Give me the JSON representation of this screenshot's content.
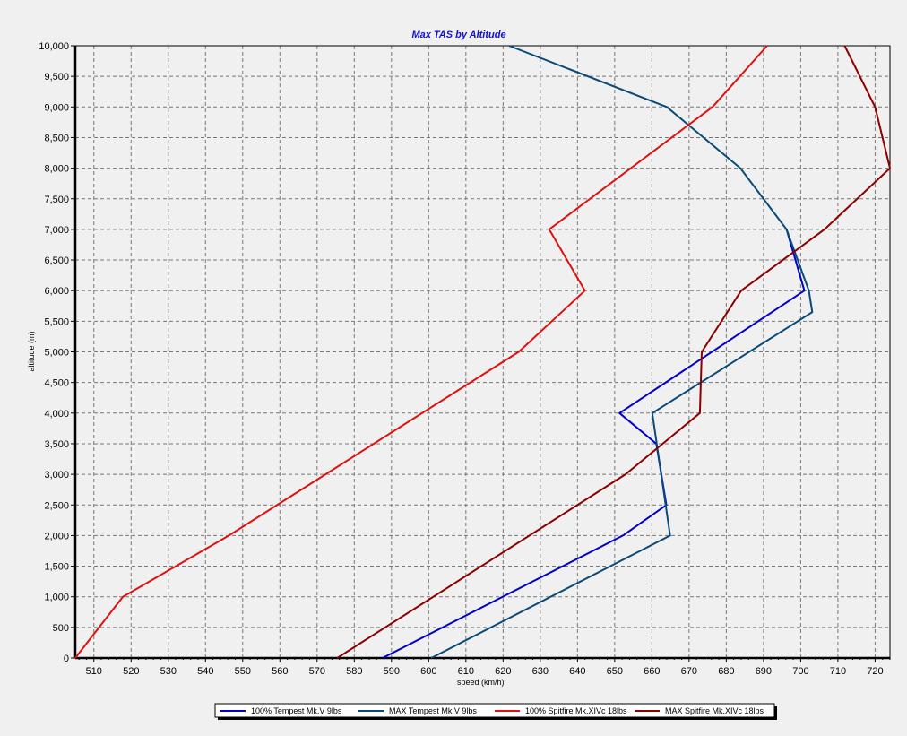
{
  "chart_data": {
    "type": "line",
    "title": "Max TAS by Altitude",
    "xlabel": "speed (km/h)",
    "ylabel": "altitude (m)",
    "xlim": [
      505,
      724
    ],
    "ylim": [
      0,
      10000
    ],
    "xticks": [
      510,
      520,
      530,
      540,
      550,
      560,
      570,
      580,
      590,
      600,
      610,
      620,
      630,
      640,
      650,
      660,
      670,
      680,
      690,
      700,
      710,
      720
    ],
    "yticks": [
      0,
      500,
      1000,
      1500,
      2000,
      2500,
      3000,
      3500,
      4000,
      4500,
      5000,
      5500,
      6000,
      6500,
      7000,
      7500,
      8000,
      8500,
      9000,
      9500,
      10000
    ],
    "ytick_labels": [
      "0",
      "500",
      "1,000",
      "1,500",
      "2,000",
      "2,500",
      "3,000",
      "3,500",
      "4,000",
      "4,500",
      "5,000",
      "5,500",
      "6,000",
      "6,500",
      "7,000",
      "7,500",
      "8,000",
      "8,500",
      "9,000",
      "9,500",
      "10,000"
    ],
    "grid": true,
    "legend_position": "bottom",
    "series": [
      {
        "name": "100% Tempest Mk.V  9lbs",
        "color": "#0000cc",
        "points": [
          [
            587.6,
            0
          ],
          [
            652.2,
            2000
          ],
          [
            663.9,
            2500
          ],
          [
            661.2,
            3500
          ],
          [
            651.3,
            4000
          ],
          [
            701.0,
            6000
          ],
          [
            696.2,
            7000
          ]
        ]
      },
      {
        "name": "MAX Tempest Mk.V  9lbs",
        "color": "#0b4a78",
        "points": [
          [
            600.7,
            0
          ],
          [
            664.9,
            2000
          ],
          [
            660.1,
            4000
          ],
          [
            703.1,
            5650
          ],
          [
            702.2,
            6000
          ],
          [
            696.2,
            7000
          ],
          [
            683.8,
            8000
          ],
          [
            664.0,
            9000
          ],
          [
            621.6,
            10000
          ]
        ]
      },
      {
        "name": "100% Spitfire Mk.XIVc 18lbs",
        "color": "#e01010",
        "points": [
          [
            505.0,
            0
          ],
          [
            517.8,
            1000
          ],
          [
            546.3,
            2000
          ],
          [
            624.2,
            5000
          ],
          [
            642.0,
            6000
          ],
          [
            632.4,
            7000
          ],
          [
            676.3,
            9000
          ],
          [
            691.0,
            10000
          ]
        ]
      },
      {
        "name": "MAX Spitfire Mk.XIVc 18lbs",
        "color": "#8b0000",
        "points": [
          [
            575.4,
            0
          ],
          [
            652.9,
            3000
          ],
          [
            672.9,
            4000
          ],
          [
            673.4,
            5000
          ],
          [
            684.0,
            6000
          ],
          [
            706.4,
            7000
          ],
          [
            724.0,
            8000
          ],
          [
            720.0,
            9000
          ],
          [
            711.8,
            10000
          ]
        ]
      }
    ]
  }
}
